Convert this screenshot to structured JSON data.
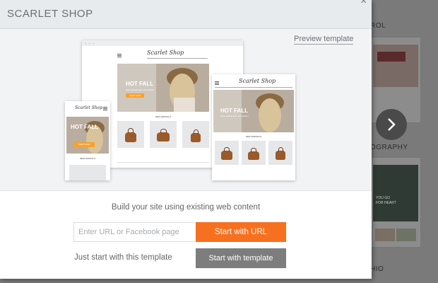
{
  "modal": {
    "title": "SCARLET SHOP",
    "close_glyph": "×",
    "preview_link": "Preview template",
    "build_text": "Build your site using existing web content",
    "url_placeholder": "Enter URL or Facebook page",
    "start_url_label": "Start with URL",
    "just_start_text": "Just start with this template",
    "start_template_label": "Start with template"
  },
  "mockup": {
    "logo": "Scarlet Shop",
    "hero_title": "HOT FALL",
    "hero_sub": "Shop jackets and new season",
    "hero_btn": "SHOP NOW",
    "section": "NEW ARRIVALS"
  },
  "background": {
    "labels": [
      "ROL",
      "OGRAPHY",
      "HIO"
    ],
    "card_text": [
      "YOU GO",
      "FOR HEART"
    ]
  },
  "icons": {
    "next": "chevron-right-icon",
    "close": "close-icon",
    "menu": "menu-icon"
  },
  "colors": {
    "accent": "#f7701f",
    "template_button": "#7d7d7d",
    "header_bg": "#e8ebed"
  }
}
